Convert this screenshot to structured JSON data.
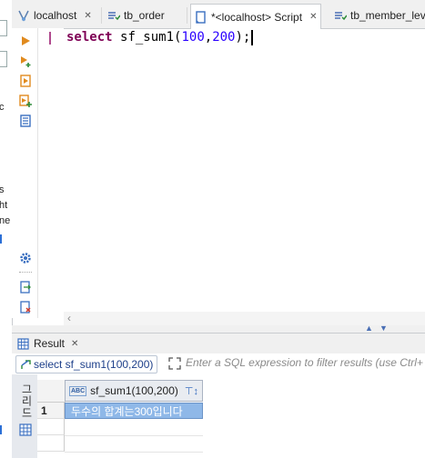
{
  "left_panel": {
    "fragments": [
      "c",
      "s",
      "ht",
      "ne"
    ]
  },
  "tabs": [
    {
      "label": "localhost",
      "active": false
    },
    {
      "label": "tb_order",
      "active": false
    },
    {
      "label": "*<localhost> Script",
      "active": true
    },
    {
      "label": "tb_member_leve",
      "active": false
    }
  ],
  "editor": {
    "code": {
      "keyword": "select",
      "function": "sf_sum1",
      "open": "(",
      "arg1": "100",
      "comma": ",",
      "arg2": "200",
      "close": ");"
    }
  },
  "result": {
    "tab_label": "Result",
    "query_label": "select sf_sum1(100,200)",
    "filter_placeholder": "Enter a SQL expression to filter results (use Ctrl+",
    "side_label": "그리드",
    "column": "sf_sum1(100,200)",
    "rows": [
      {
        "num": "1",
        "value": "두수의 합계는300입니다"
      }
    ]
  },
  "colors": {
    "keyword": "#7f0055",
    "number": "#2a00ff",
    "selection": "#8fb8e8",
    "accent": "#2b5aa0"
  }
}
